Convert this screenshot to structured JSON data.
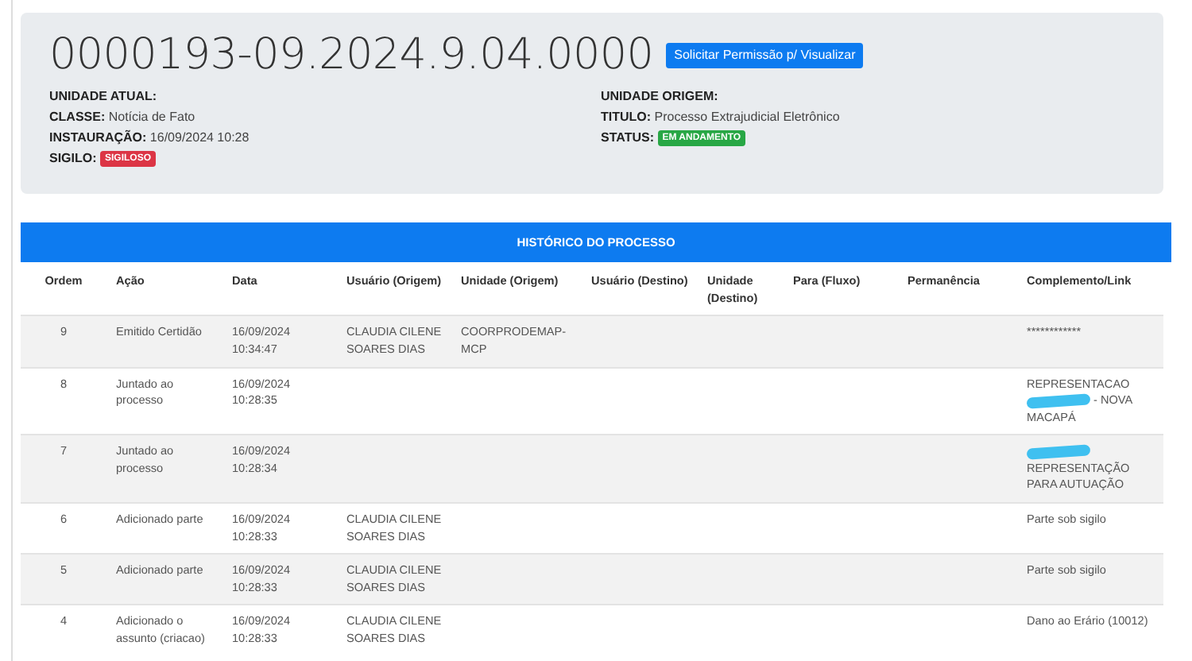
{
  "header": {
    "process_number": "0000193-09.2024.9.04.0000",
    "request_button": "Solicitar Permissão p/ Visualizar",
    "left_fields": [
      {
        "label": "UNIDADE ATUAL:"
      },
      {
        "label": "CLASSE:",
        "value": "Notícia de Fato"
      },
      {
        "label": "INSTAURAÇÃO:",
        "value": "16/09/2024 10:28"
      },
      {
        "label": "SIGILO:",
        "badge": "SIGILOSO",
        "color": "#dc3545"
      }
    ],
    "right_fields": [
      {
        "label": "UNIDADE ORIGEM:"
      },
      {
        "label": "TITULO:",
        "value": "Processo Extrajudicial Eletrônico"
      },
      {
        "label": "STATUS:",
        "badge": "EM ANDAMENTO",
        "color": "#28a745"
      }
    ]
  },
  "history": {
    "title": "HISTÓRICO DO PROCESSO",
    "columns": [
      "Ordem",
      "Ação",
      "Data",
      "Usuário (Origem)",
      "Unidade (Origem)",
      "Usuário (Destino)",
      "Unidade (Destino)",
      "Para (Fluxo)",
      "Permanência",
      "Complemento/Link"
    ],
    "rows": [
      {
        "ordem": "9",
        "acao": "Emitido Certidão",
        "data": "16/09/2024 10:34:47",
        "usuario_origem": "CLAUDIA CILENE SOARES DIAS",
        "unidade_origem": "COORPRODEMAP-MCP",
        "complemento": [
          {
            "kind": "text",
            "text": "************"
          }
        ]
      },
      {
        "ordem": "8",
        "acao": "Juntado ao processo",
        "data": "16/09/2024 10:28:35",
        "complemento": [
          {
            "kind": "text",
            "text": "REPRESENTACAO"
          },
          {
            "kind": "redaction"
          },
          {
            "kind": "text",
            "text": "- NOVA"
          },
          {
            "kind": "text",
            "text": "MACAPÁ"
          }
        ]
      },
      {
        "ordem": "7",
        "acao": "Juntado ao processo",
        "data": "16/09/2024 10:28:34",
        "complemento": [
          {
            "kind": "redaction"
          },
          {
            "kind": "text",
            "text": "REPRESENTAÇÃO PARA AUTUAÇÃO"
          }
        ]
      },
      {
        "ordem": "6",
        "acao": "Adicionado parte",
        "data": "16/09/2024 10:28:33",
        "usuario_origem": "CLAUDIA CILENE SOARES DIAS",
        "complemento": [
          {
            "kind": "text",
            "text": "Parte sob sigilo"
          }
        ]
      },
      {
        "ordem": "5",
        "acao": "Adicionado parte",
        "data": "16/09/2024 10:28:33",
        "usuario_origem": "CLAUDIA CILENE SOARES DIAS",
        "complemento": [
          {
            "kind": "text",
            "text": "Parte sob sigilo"
          }
        ]
      },
      {
        "ordem": "4",
        "acao": "Adicionado o assunto (criacao)",
        "data": "16/09/2024 10:28:33",
        "usuario_origem": "CLAUDIA CILENE SOARES DIAS",
        "complemento": [
          {
            "kind": "text",
            "text": "Dano ao Erário (10012)"
          }
        ]
      }
    ]
  }
}
